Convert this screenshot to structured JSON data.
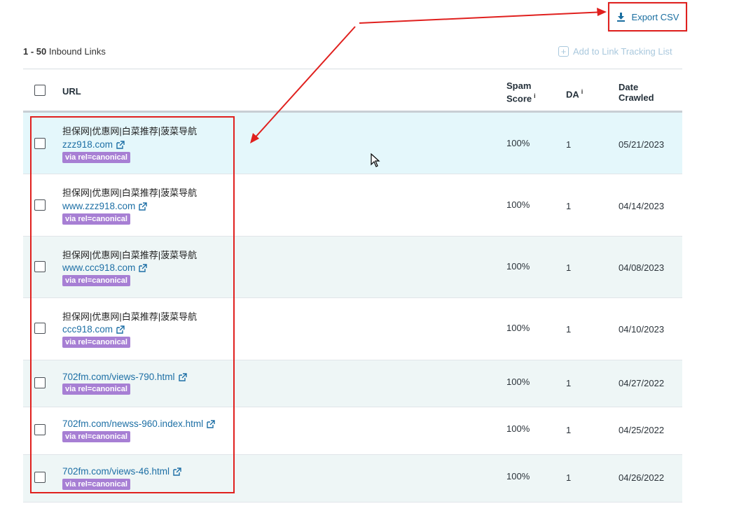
{
  "toolbar": {
    "export_label": "Export CSV",
    "export_icon": "download-icon",
    "add_tracking_label": "Add to Link Tracking List",
    "add_tracking_icon": "plus-square-icon"
  },
  "summary": {
    "range": "1 - 50",
    "label": "Inbound Links"
  },
  "table": {
    "columns": {
      "url": "URL",
      "spam_line1": "Spam",
      "spam_line2": "Score",
      "da": "DA",
      "date_line1": "Date",
      "date_line2": "Crawled",
      "info_glyph": "i"
    },
    "rows": [
      {
        "title": "担保网|优惠网|白菜推荐|菠菜导航",
        "url": "zzz918.com",
        "badge": "via rel=canonical",
        "spam": "100%",
        "da": "1",
        "date": "05/21/2023"
      },
      {
        "title": "担保网|优惠网|白菜推荐|菠菜导航",
        "url": "www.zzz918.com",
        "badge": "via rel=canonical",
        "spam": "100%",
        "da": "1",
        "date": "04/14/2023"
      },
      {
        "title": "担保网|优惠网|白菜推荐|菠菜导航",
        "url": "www.ccc918.com",
        "badge": "via rel=canonical",
        "spam": "100%",
        "da": "1",
        "date": "04/08/2023"
      },
      {
        "title": "担保网|优惠网|白菜推荐|菠菜导航",
        "url": "ccc918.com",
        "badge": "via rel=canonical",
        "spam": "100%",
        "da": "1",
        "date": "04/10/2023"
      },
      {
        "title": "",
        "url": "702fm.com/views-790.html",
        "badge": "via rel=canonical",
        "spam": "100%",
        "da": "1",
        "date": "04/27/2022"
      },
      {
        "title": "",
        "url": "702fm.com/newss-960.index.html",
        "badge": "via rel=canonical",
        "spam": "100%",
        "da": "1",
        "date": "04/25/2022"
      },
      {
        "title": "",
        "url": "702fm.com/views-46.html",
        "badge": "via rel=canonical",
        "spam": "100%",
        "da": "1",
        "date": "04/26/2022"
      }
    ]
  },
  "colors": {
    "accent_link": "#1d6fa5",
    "badge": "#a77fd4",
    "annotation_red": "#e0201e",
    "row_shade": "#eef6f6",
    "row_hover": "#e4f7fb"
  }
}
